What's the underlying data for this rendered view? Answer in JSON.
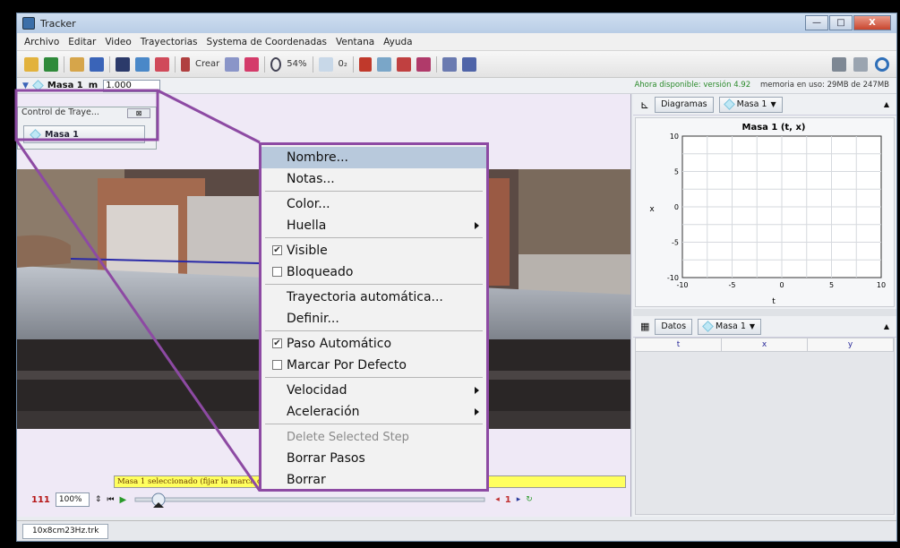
{
  "window": {
    "title": "Tracker"
  },
  "window_controls": {
    "minimize": "—",
    "maximize": "□",
    "close": "X"
  },
  "menu": [
    "Archivo",
    "Editar",
    "Video",
    "Trayectorias",
    "Systema de Coordenadas",
    "Ventana",
    "Ayuda"
  ],
  "toolbar": {
    "create_label": "Crear",
    "zoom_label": "54%",
    "step_label": "0₂"
  },
  "trackbar": {
    "track_name": "Masa 1",
    "mass_label": "m",
    "mass_value": "1.000",
    "available": "Ahora disponible: versión 4.92",
    "memory": "memoria en uso: 29MB de 247MB"
  },
  "control_panel": {
    "title": "Control de Traye...",
    "close": "⊠",
    "track_button": "Masa 1"
  },
  "status_strip": "Masa 1 seleccionado (fijar la marca con shift-clic para marcar posiciones)",
  "player": {
    "frame": "111",
    "zoom": "100%",
    "step_start": "1"
  },
  "plot_panel": {
    "button_label": "Diagramas",
    "track_label": "Masa 1"
  },
  "chart_data": {
    "type": "line",
    "title": "Masa 1 (t, x)",
    "xlabel": "t",
    "ylabel": "x",
    "xlim": [
      -10,
      10
    ],
    "ylim": [
      -10,
      10
    ],
    "xticks": [
      "-10",
      "-5",
      "0",
      "5",
      "10"
    ],
    "yticks": [
      "10",
      "5",
      "0",
      "-5",
      "-10"
    ],
    "grid": true,
    "series": []
  },
  "table_panel": {
    "button_label": "Datos",
    "track_label": "Masa 1",
    "columns": [
      "t",
      "x",
      "y"
    ]
  },
  "context_menu": {
    "items": [
      {
        "label": "Nombre...",
        "highlighted": true,
        "submenu": false
      },
      {
        "label": "Notas...",
        "submenu": false
      },
      {
        "label": "Color...",
        "submenu": false
      },
      {
        "label": "Huella",
        "submenu": true
      },
      {
        "label": "Visible",
        "checked": true
      },
      {
        "label": "Bloqueado",
        "checked": false
      },
      {
        "label": "Trayectoria automática..."
      },
      {
        "label": "Definir..."
      },
      {
        "label": "Paso Automático",
        "checked": true
      },
      {
        "label": "Marcar Por Defecto",
        "checked": false
      },
      {
        "label": "Velocidad",
        "submenu": true
      },
      {
        "label": "Aceleración",
        "submenu": true
      },
      {
        "label": "Delete Selected Step",
        "disabled": true
      },
      {
        "label": "Borrar Pasos"
      },
      {
        "label": "Borrar"
      }
    ]
  },
  "file_tab": "10x8cm23Hz.trk",
  "colors": {
    "callout": "#8d4aa3",
    "status_bg": "#ffff5e",
    "available_text": "#2a8a2a"
  }
}
